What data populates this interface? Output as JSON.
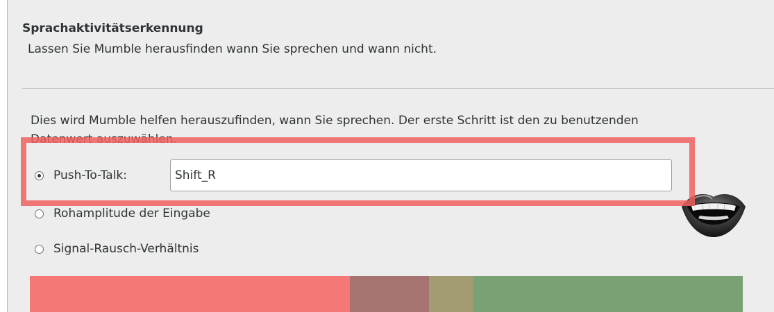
{
  "wizard": {
    "title": "Sprachaktivitätserkennung",
    "subtitle": "Lassen Sie Mumble herausfinden wann Sie sprechen und wann nicht."
  },
  "content": {
    "description": "Dies wird Mumble helfen herauszufinden, wann Sie sprechen. Der erste Schritt ist den zu benutzenden Datenwert auszuwählen.",
    "options": {
      "push_to_talk": {
        "label": "Push-To-Talk:",
        "selected": true
      },
      "raw_amplitude": {
        "label": "Rohamplitude der Eingabe",
        "selected": false
      },
      "signal_noise": {
        "label": "Signal-Rausch-Verhältnis",
        "selected": false
      }
    },
    "ptt_key": {
      "value": "Shift_R"
    }
  },
  "icons": {
    "talking": "mouth-icon"
  },
  "level_meter": {
    "segments": [
      {
        "name": "silence",
        "fraction": 0.449,
        "color": "#f47875"
      },
      {
        "name": "transition",
        "fraction": 0.111,
        "color": "#a57471"
      },
      {
        "name": "threshold",
        "fraction": 0.062,
        "color": "#a39c73"
      },
      {
        "name": "speech",
        "fraction": 0.378,
        "color": "#78a273"
      }
    ]
  },
  "annotation": {
    "highlight_color": "#f05f5f"
  }
}
